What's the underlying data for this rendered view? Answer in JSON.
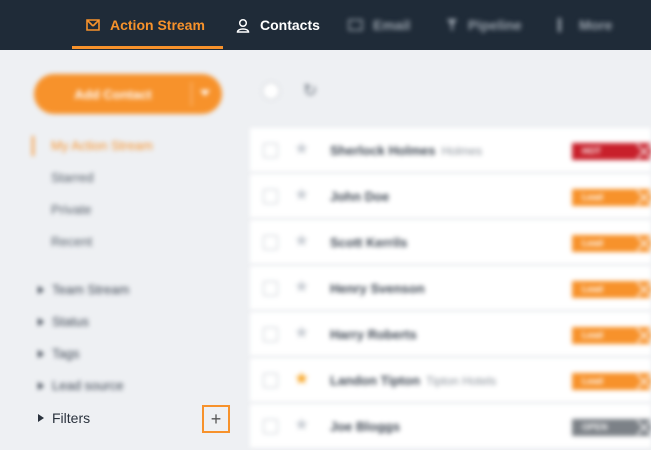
{
  "nav": {
    "items": [
      {
        "label": "Action Stream",
        "icon": "action-stream-icon",
        "active": true
      },
      {
        "label": "Contacts",
        "icon": "user-icon",
        "active": false
      },
      {
        "label": "Email",
        "icon": "email-icon",
        "active": false
      },
      {
        "label": "Pipeline",
        "icon": "filter-icon",
        "active": false
      },
      {
        "label": "More",
        "icon": "more-icon",
        "active": false
      }
    ],
    "accent_color": "#f7922b",
    "bg_color": "#1f2b38"
  },
  "sidebar": {
    "add_button_label": "Add Contact",
    "links": [
      "My Action Stream",
      "Starred",
      "Private",
      "Recent"
    ],
    "groups": [
      "Team Stream",
      "Status",
      "Tags",
      "Lead source",
      "Filters"
    ],
    "add_filter_symbol": "+"
  },
  "list": {
    "rows": [
      {
        "name": "Sherlock Holmes",
        "company": "Holmes",
        "starred": false,
        "tag": "HOT",
        "tag_color": "#c8202b"
      },
      {
        "name": "John Doe",
        "company": "",
        "starred": false,
        "tag": "Lead",
        "tag_color": "#f7922b"
      },
      {
        "name": "Scott Kerrils",
        "company": "",
        "starred": false,
        "tag": "Lead",
        "tag_color": "#f7922b"
      },
      {
        "name": "Henry Svenson",
        "company": "",
        "starred": false,
        "tag": "Lead",
        "tag_color": "#f7922b"
      },
      {
        "name": "Harry Roberts",
        "company": "",
        "starred": false,
        "tag": "Lead",
        "tag_color": "#f7922b"
      },
      {
        "name": "Landon Tipton",
        "company": "Tipton Hotels",
        "starred": true,
        "tag": "Lead",
        "tag_color": "#f7922b"
      },
      {
        "name": "Joe Bloggs",
        "company": "",
        "starred": false,
        "tag": "OPEN",
        "tag_color": "#7c8187"
      }
    ]
  }
}
